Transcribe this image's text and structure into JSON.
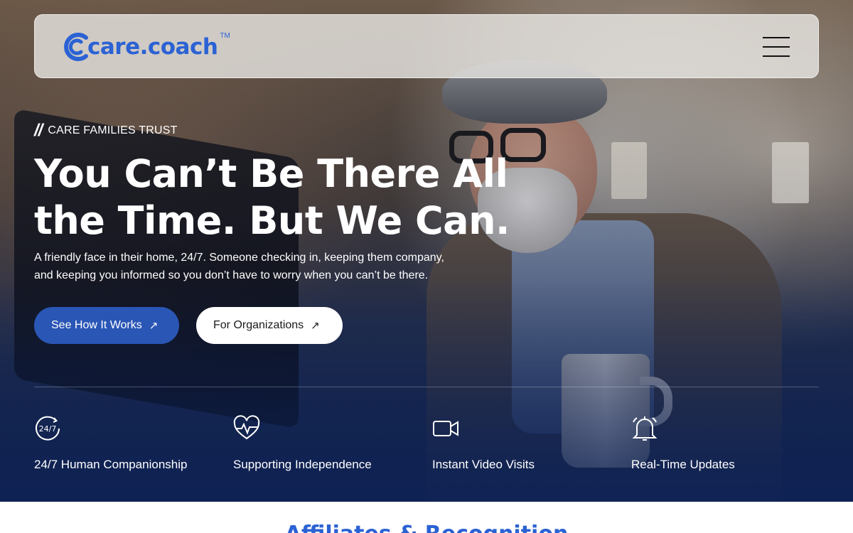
{
  "header": {
    "logo_text": "care.coach",
    "logo_tm": "TM",
    "menu_icon": "hamburger-menu-icon"
  },
  "hero": {
    "eyebrow_mark": "//",
    "eyebrow": "CARE FAMILIES TRUST",
    "headline_line1": "You Can’t Be There All",
    "headline_line2": "the Time. But We Can.",
    "subtext_line1": "A friendly face in their home, 24/7. Someone checking in, keeping them company,",
    "subtext_line2": "and keeping you informed so you don’t have to worry when you can’t be there.",
    "primary_cta": "See How It Works",
    "secondary_cta": "For Organizations",
    "arrow": "↗"
  },
  "features": [
    {
      "icon": "24-7-clock-icon",
      "label": "24/7 Human Companionship"
    },
    {
      "icon": "heartbeat-icon",
      "label": "Supporting Independence"
    },
    {
      "icon": "video-camera-icon",
      "label": "Instant Video Visits"
    },
    {
      "icon": "bell-icon",
      "label": "Real-Time Updates"
    }
  ],
  "affiliates": {
    "title": "Affiliates & Recognition"
  },
  "colors": {
    "brand_blue": "#2b62d4",
    "button_blue": "#2a56b6",
    "navy": "#14254f"
  }
}
